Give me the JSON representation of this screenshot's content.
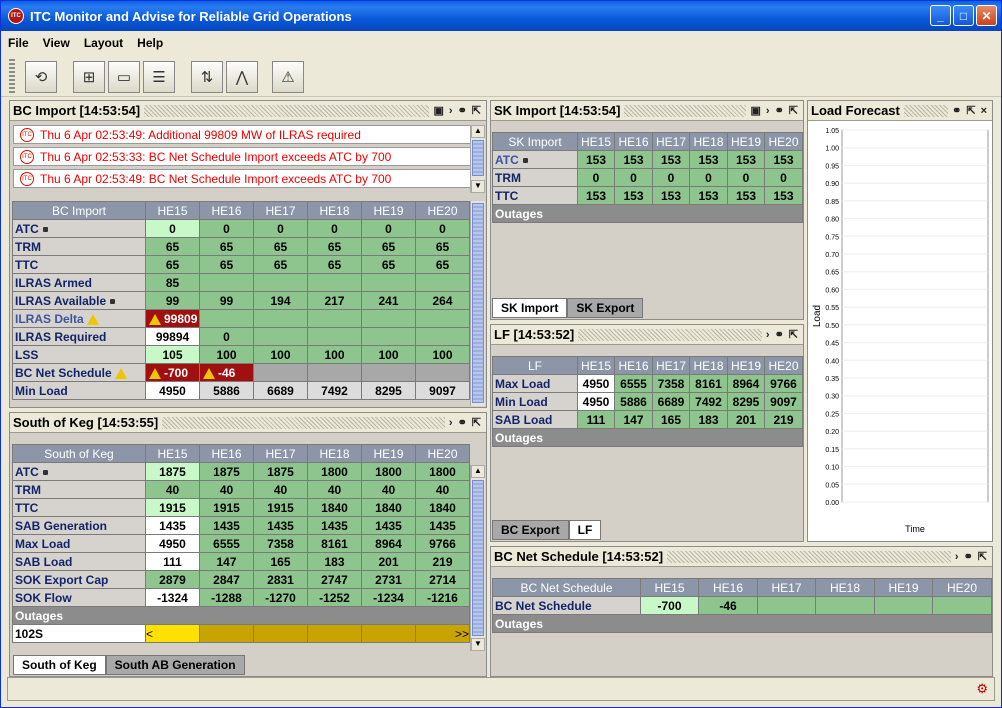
{
  "window": {
    "title": "ITC Monitor and Advise for Reliable Grid Operations"
  },
  "menu": [
    "File",
    "View",
    "Layout",
    "Help"
  ],
  "hours": [
    "HE15",
    "HE16",
    "HE17",
    "HE18",
    "HE19",
    "HE20"
  ],
  "bc_import": {
    "title": "BC Import [14:53:54]",
    "alerts": [
      "Thu 6 Apr 02:53:49: Additional 99809 MW of ILRAS required",
      "Thu 6 Apr 02:53:33: BC Net Schedule Import exceeds ATC by 700",
      "Thu 6 Apr 02:53:49: BC Net Schedule Import exceeds ATC by 700"
    ],
    "header": "BC Import",
    "rows": [
      {
        "label": "ATC",
        "values": [
          "0",
          "0",
          "0",
          "0",
          "0",
          "0"
        ]
      },
      {
        "label": "TRM",
        "values": [
          "65",
          "65",
          "65",
          "65",
          "65",
          "65"
        ]
      },
      {
        "label": "TTC",
        "values": [
          "65",
          "65",
          "65",
          "65",
          "65",
          "65"
        ]
      },
      {
        "label": "ILRAS Armed",
        "values": [
          "85",
          "",
          "",
          "",
          "",
          ""
        ]
      },
      {
        "label": "ILRAS Available",
        "values": [
          "99",
          "99",
          "194",
          "217",
          "241",
          "264"
        ]
      },
      {
        "label": "ILRAS Delta",
        "values": [
          "99809",
          "",
          "",
          "",
          "",
          ""
        ]
      },
      {
        "label": "ILRAS Required",
        "values": [
          "99894",
          "0",
          "",
          "",
          "",
          ""
        ]
      },
      {
        "label": "LSS",
        "values": [
          "105",
          "100",
          "100",
          "100",
          "100",
          "100"
        ]
      },
      {
        "label": "BC Net Schedule",
        "values": [
          "-700",
          "-46",
          "",
          "",
          "",
          ""
        ]
      },
      {
        "label": "Min Load",
        "values": [
          "4950",
          "5886",
          "6689",
          "7492",
          "8295",
          "9097"
        ]
      }
    ]
  },
  "south_of_keg": {
    "title": "South of Keg [14:53:55]",
    "header": "South of Keg",
    "rows": [
      {
        "label": "ATC",
        "values": [
          "1875",
          "1875",
          "1875",
          "1800",
          "1800",
          "1800"
        ]
      },
      {
        "label": "TRM",
        "values": [
          "40",
          "40",
          "40",
          "40",
          "40",
          "40"
        ]
      },
      {
        "label": "TTC",
        "values": [
          "1915",
          "1915",
          "1915",
          "1840",
          "1840",
          "1840"
        ]
      },
      {
        "label": "SAB Generation",
        "values": [
          "1435",
          "1435",
          "1435",
          "1435",
          "1435",
          "1435"
        ]
      },
      {
        "label": "Max Load",
        "values": [
          "4950",
          "6555",
          "7358",
          "8161",
          "8964",
          "9766"
        ]
      },
      {
        "label": "SAB Load",
        "values": [
          "111",
          "147",
          "165",
          "183",
          "201",
          "219"
        ]
      },
      {
        "label": "SOK Export Cap",
        "values": [
          "2879",
          "2847",
          "2831",
          "2747",
          "2731",
          "2714"
        ]
      },
      {
        "label": "SOK Flow",
        "values": [
          "-1324",
          "-1288",
          "-1270",
          "-1252",
          "-1234",
          "-1216"
        ]
      }
    ],
    "outages_label": "Outages",
    "outage_row": {
      "label": "102S",
      "start": "<",
      "end": ">>"
    },
    "tabs": [
      "South of Keg",
      "South AB Generation"
    ]
  },
  "sk_import": {
    "title": "SK Import [14:53:54]",
    "header": "SK Import",
    "rows": [
      {
        "label": "ATC",
        "values": [
          "153",
          "153",
          "153",
          "153",
          "153",
          "153"
        ]
      },
      {
        "label": "TRM",
        "values": [
          "0",
          "0",
          "0",
          "0",
          "0",
          "0"
        ]
      },
      {
        "label": "TTC",
        "values": [
          "153",
          "153",
          "153",
          "153",
          "153",
          "153"
        ]
      }
    ],
    "outages_label": "Outages",
    "tabs": [
      "SK Import",
      "SK Export"
    ]
  },
  "lf": {
    "title": "LF [14:53:52]",
    "header": "LF",
    "rows": [
      {
        "label": "Max Load",
        "values": [
          "4950",
          "6555",
          "7358",
          "8161",
          "8964",
          "9766"
        ]
      },
      {
        "label": "Min Load",
        "values": [
          "4950",
          "5886",
          "6689",
          "7492",
          "8295",
          "9097"
        ]
      },
      {
        "label": "SAB Load",
        "values": [
          "111",
          "147",
          "165",
          "183",
          "201",
          "219"
        ]
      }
    ],
    "outages_label": "Outages",
    "tabs": [
      "BC Export",
      "LF"
    ]
  },
  "load_forecast": {
    "title": "Load Forecast",
    "ylabel": "Load",
    "xlabel": "Time",
    "ticks": [
      "1.05",
      "1.00",
      "0.95",
      "0.90",
      "0.85",
      "0.80",
      "0.75",
      "0.70",
      "0.65",
      "0.60",
      "0.55",
      "0.50",
      "0.45",
      "0.40",
      "0.35",
      "0.30",
      "0.25",
      "0.20",
      "0.15",
      "0.10",
      "0.05",
      "0.00"
    ]
  },
  "bc_net_schedule": {
    "title": "BC Net Schedule [14:53:52]",
    "header": "BC Net Schedule",
    "row": {
      "label": "BC Net Schedule",
      "values": [
        "-700",
        "-46",
        "",
        "",
        "",
        ""
      ]
    },
    "outages_label": "Outages"
  },
  "colors": {
    "title_bar": "#0a58d8",
    "cell_green": "#8ec48e",
    "alert_red": "#a01010",
    "header_blue": "#8c96a8"
  }
}
